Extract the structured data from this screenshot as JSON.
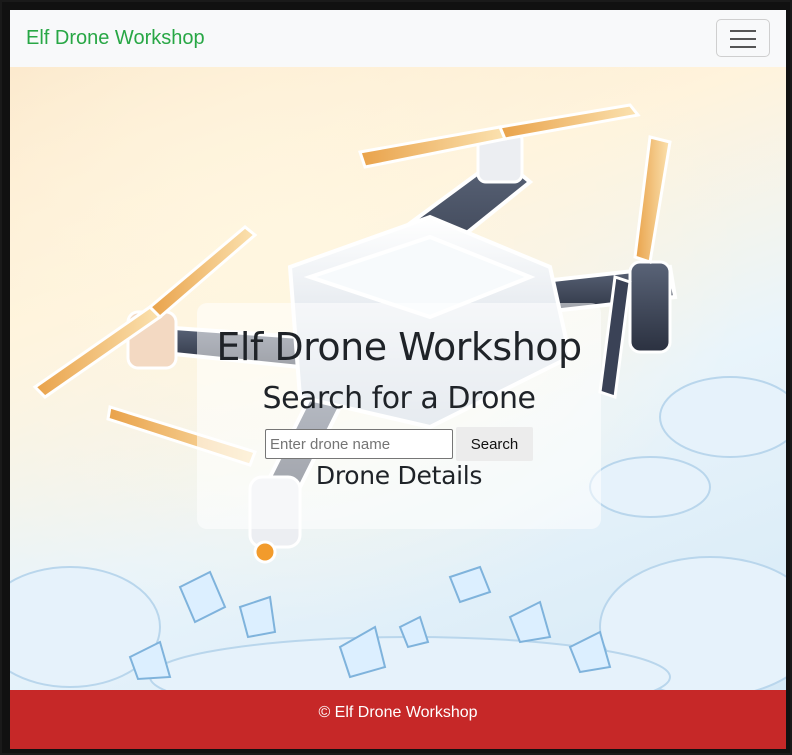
{
  "navbar": {
    "brand": "Elf Drone Workshop",
    "toggler_icon": "hamburger-menu-icon"
  },
  "hero": {
    "title": "Elf Drone Workshop",
    "search_heading": "Search for a Drone",
    "search_placeholder": "Enter drone name",
    "search_button": "Search",
    "details_heading": "Drone Details"
  },
  "footer": {
    "text": "© Elf Drone Workshop"
  },
  "colors": {
    "brand_green": "#28a745",
    "footer_red": "#c62828",
    "navbar_bg": "#f8f9fa"
  }
}
